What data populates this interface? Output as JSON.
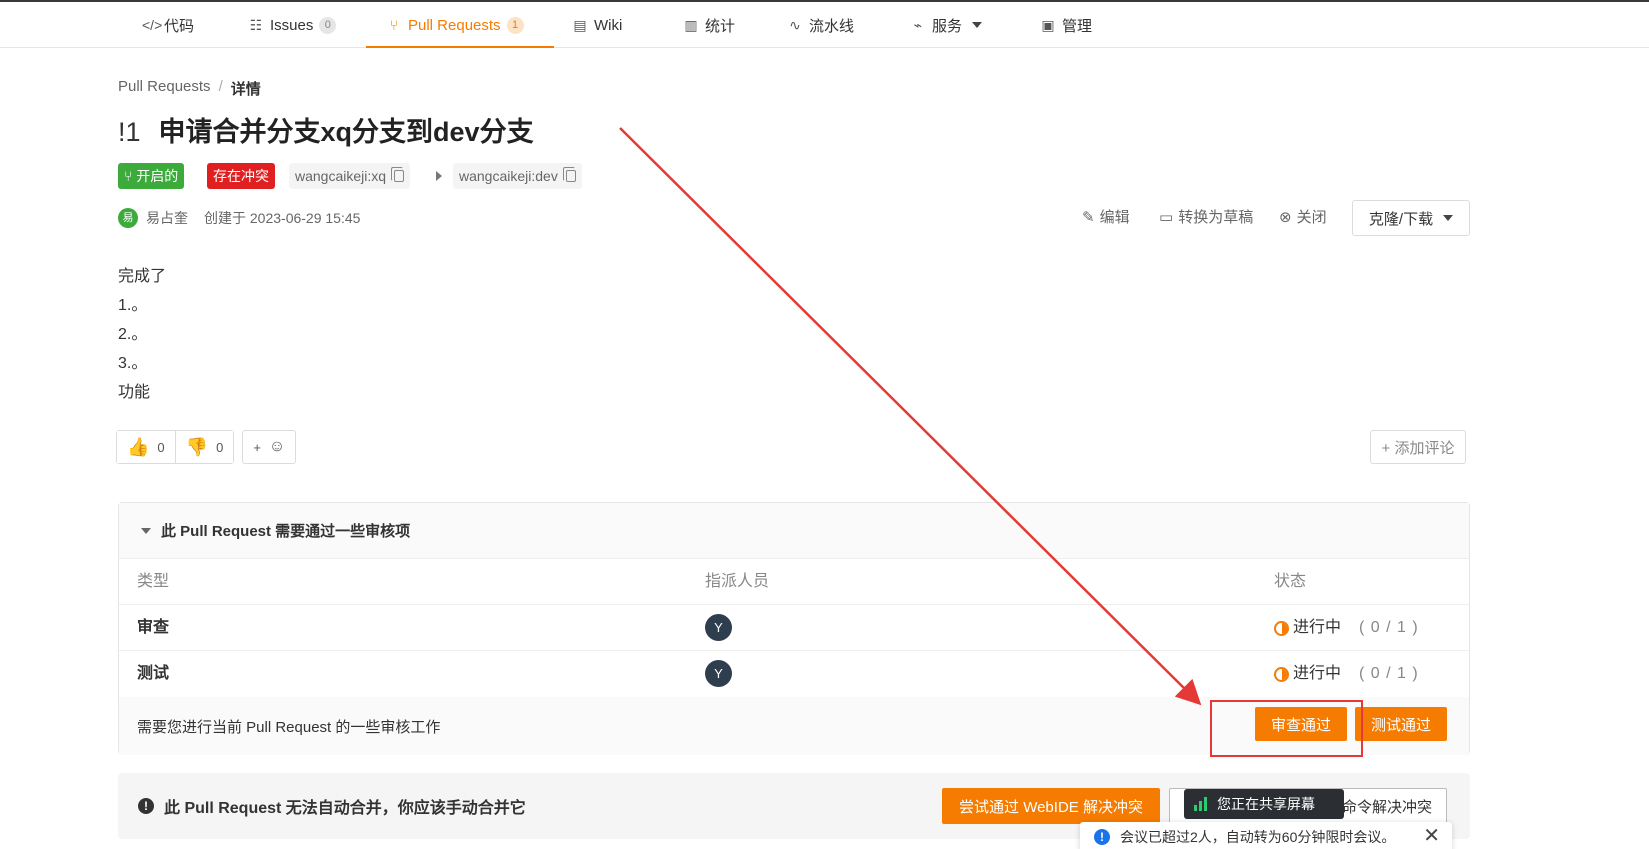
{
  "nav": {
    "code": "代码",
    "issues": "Issues",
    "issues_count": "0",
    "pull_requests": "Pull Requests",
    "pull_requests_count": "1",
    "wiki": "Wiki",
    "stats": "统计",
    "pipeline": "流水线",
    "services": "服务",
    "manage": "管理"
  },
  "breadcrumb": {
    "root": "Pull Requests",
    "sep": "/",
    "current": "详情"
  },
  "pr": {
    "number": "!1",
    "title": "申请合并分支xq分支到dev分支",
    "status_open": "开启的",
    "status_conflict": "存在冲突",
    "source_branch": "wangcaikeji:xq",
    "target_branch": "wangcaikeji:dev",
    "author_initial": "易",
    "author": "易占奎",
    "created": "创建于 2023-06-29 15:45"
  },
  "actions": {
    "edit": "编辑",
    "draft": "转换为草稿",
    "close": "关闭",
    "clone": "克隆/下载"
  },
  "description": [
    "完成了",
    "1.。",
    "2.。",
    "3.。",
    "功能"
  ],
  "reactions": {
    "thumbs_up": "0",
    "thumbs_down": "0",
    "add": "+",
    "add_comment": "+ 添加评论"
  },
  "review": {
    "header": "此 Pull Request 需要通过一些审核项",
    "columns": [
      "类型",
      "指派人员",
      "状态"
    ],
    "rows": [
      {
        "type": "审查",
        "assignee": "Y",
        "status": "进行中",
        "progress": "( 0 / 1 )"
      },
      {
        "type": "测试",
        "assignee": "Y",
        "status": "进行中",
        "progress": "( 0 / 1 )"
      }
    ],
    "footer_text": "需要您进行当前 Pull Request 的一些审核工作",
    "approve_review": "审查通过",
    "approve_test": "测试通过"
  },
  "merge": {
    "message": "此 Pull Request 无法自动合并，你应该手动合并它",
    "webide_button": "尝试通过 WebIDE 解决冲突",
    "cmd_button": "命令解决冲突"
  },
  "overlay": {
    "share_text": "您正在共享屏幕",
    "toast_text": "会议已超过2人，自动转为60分钟限时会议。",
    "toast_close": "✕"
  },
  "colors": {
    "accent": "#f57c00",
    "open_green": "#3cab3c",
    "conflict_red": "#e02020",
    "annotation_red": "#e53935"
  }
}
